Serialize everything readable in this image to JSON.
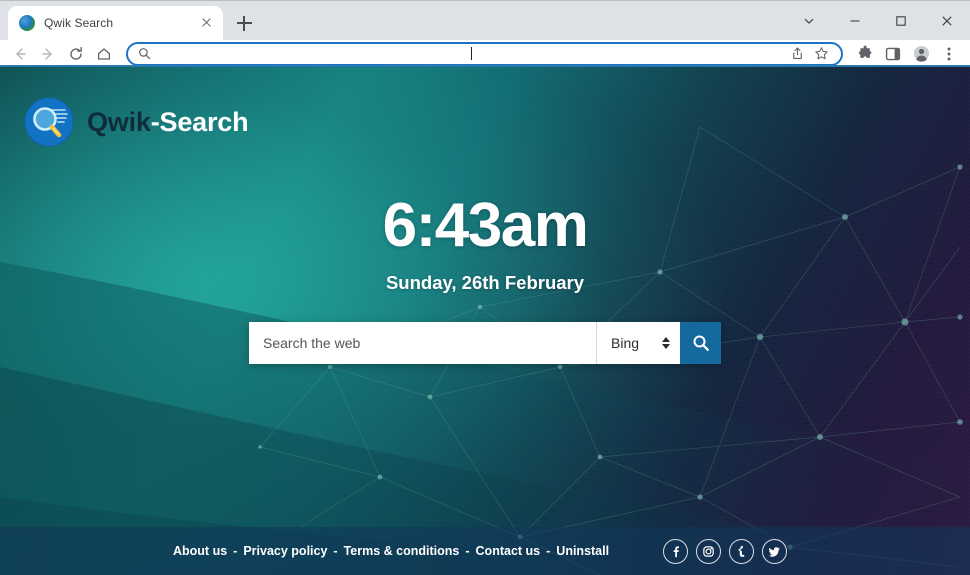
{
  "browser": {
    "tab": {
      "title": "Qwik Search",
      "favicon": "globe-favicon",
      "close": "close-icon"
    },
    "new_tab_label": "+",
    "window_controls": [
      {
        "name": "tab-search-chevron",
        "glyph": "chevron-down-icon"
      },
      {
        "name": "minimize",
        "glyph": "minimize-icon"
      },
      {
        "name": "maximize",
        "glyph": "maximize-icon"
      },
      {
        "name": "close",
        "glyph": "close-icon"
      }
    ],
    "nav": [
      {
        "name": "back",
        "glyph": "arrow-left-icon"
      },
      {
        "name": "forward",
        "glyph": "arrow-right-icon"
      },
      {
        "name": "reload",
        "glyph": "reload-icon"
      },
      {
        "name": "home",
        "glyph": "home-icon"
      }
    ],
    "omnibox": {
      "value": "",
      "placeholder": "",
      "leading_icon": "search-icon",
      "trailing_icons": [
        {
          "name": "share",
          "glyph": "share-icon"
        },
        {
          "name": "bookmark",
          "glyph": "star-icon"
        }
      ]
    },
    "toolbar_icons": [
      {
        "name": "extensions",
        "glyph": "puzzle-icon"
      },
      {
        "name": "side-panel",
        "glyph": "side-panel-icon"
      },
      {
        "name": "profile",
        "glyph": "avatar-icon"
      },
      {
        "name": "menu",
        "glyph": "kebab-menu-icon"
      }
    ]
  },
  "page": {
    "logo": {
      "brand": "Qwik",
      "suffix": "-Search",
      "mark": "magnifier-logo-icon"
    },
    "clock": "6:43am",
    "date": "Sunday, 26th February",
    "search": {
      "placeholder": "Search the web",
      "value": "",
      "engine": "Bing",
      "engine_options": [
        "Bing"
      ],
      "button_icon": "search-icon"
    },
    "footer": {
      "links": [
        "About us",
        "Privacy policy",
        "Terms & conditions",
        "Contact us",
        "Uninstall"
      ],
      "separator": "-",
      "socials": [
        {
          "name": "facebook",
          "glyph": "f"
        },
        {
          "name": "instagram",
          "glyph": "instagram-icon"
        },
        {
          "name": "tumblr",
          "glyph": "t"
        },
        {
          "name": "twitter",
          "glyph": "twitter-icon"
        }
      ]
    }
  },
  "colors": {
    "accent_blue": "#14699f",
    "chrome_tabstrip": "#dee1e6",
    "omnibox_focus": "#1a73c8",
    "footer_bar": "rgba(17,55,92,0.58)"
  }
}
